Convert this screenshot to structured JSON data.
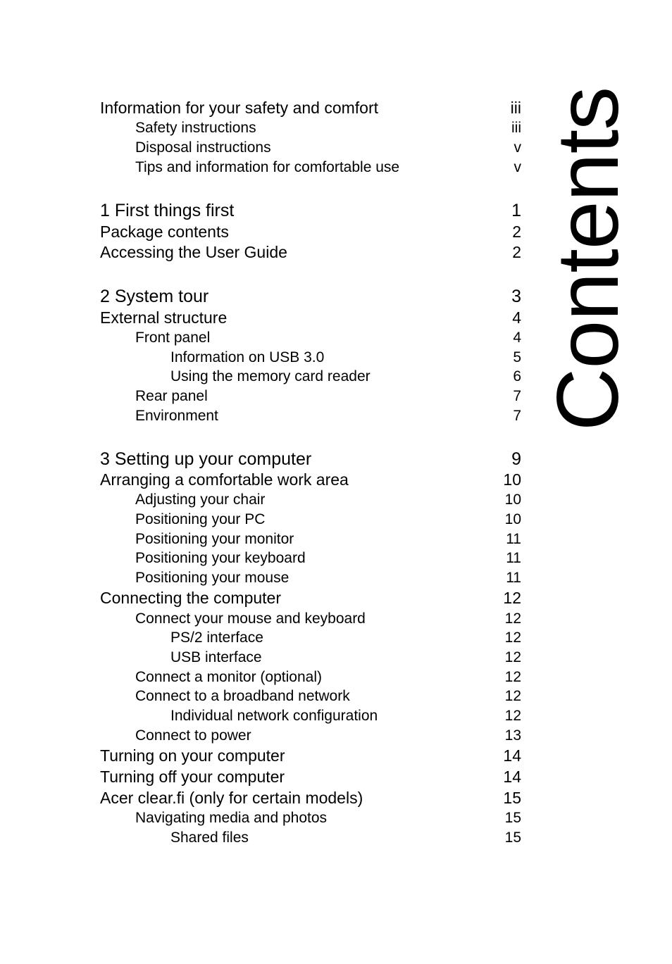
{
  "title": "Contents",
  "entries": [
    {
      "text": "Information for your safety and comfort",
      "page": "iii",
      "level": 1
    },
    {
      "text": "Safety instructions",
      "page": "iii",
      "level": 2
    },
    {
      "text": "Disposal instructions",
      "page": "v",
      "level": 2
    },
    {
      "text": "Tips and information for comfortable use",
      "page": "v",
      "level": 2
    },
    {
      "text": "1  First things first",
      "page": "1",
      "level": 0
    },
    {
      "text": "Package contents",
      "page": "2",
      "level": 1
    },
    {
      "text": "Accessing the User Guide",
      "page": "2",
      "level": 1
    },
    {
      "text": "2  System tour",
      "page": "3",
      "level": 0
    },
    {
      "text": "External structure",
      "page": "4",
      "level": 1
    },
    {
      "text": "Front panel",
      "page": "4",
      "level": 2
    },
    {
      "text": "Information on USB 3.0",
      "page": "5",
      "level": 3
    },
    {
      "text": "Using the memory card reader",
      "page": "6",
      "level": 3
    },
    {
      "text": "Rear panel",
      "page": "7",
      "level": 2
    },
    {
      "text": "Environment",
      "page": "7",
      "level": 2
    },
    {
      "text": "3  Setting up your computer",
      "page": "9",
      "level": 0
    },
    {
      "text": "Arranging a comfortable work area",
      "page": "10",
      "level": 1
    },
    {
      "text": "Adjusting your chair",
      "page": "10",
      "level": 2
    },
    {
      "text": "Positioning your PC",
      "page": "10",
      "level": 2
    },
    {
      "text": "Positioning your monitor",
      "page": "11",
      "level": 2
    },
    {
      "text": "Positioning your keyboard",
      "page": "11",
      "level": 2
    },
    {
      "text": "Positioning your mouse",
      "page": "11",
      "level": 2
    },
    {
      "text": "Connecting the computer",
      "page": "12",
      "level": 1
    },
    {
      "text": "Connect your mouse and keyboard",
      "page": "12",
      "level": 2
    },
    {
      "text": "PS/2 interface",
      "page": "12",
      "level": 3
    },
    {
      "text": "USB interface",
      "page": "12",
      "level": 3
    },
    {
      "text": "Connect a monitor (optional)",
      "page": "12",
      "level": 2
    },
    {
      "text": "Connect to a broadband network",
      "page": "12",
      "level": 2
    },
    {
      "text": "Individual network configuration",
      "page": "12",
      "level": 3
    },
    {
      "text": "Connect to power",
      "page": "13",
      "level": 2
    },
    {
      "text": "Turning on your computer",
      "page": "14",
      "level": 1
    },
    {
      "text": "Turning off your computer",
      "page": "14",
      "level": 1
    },
    {
      "text": "Acer clear.fi (only for certain models)",
      "page": "15",
      "level": 1
    },
    {
      "text": "Navigating media and photos",
      "page": "15",
      "level": 2
    },
    {
      "text": "Shared files",
      "page": "15",
      "level": 3
    }
  ]
}
